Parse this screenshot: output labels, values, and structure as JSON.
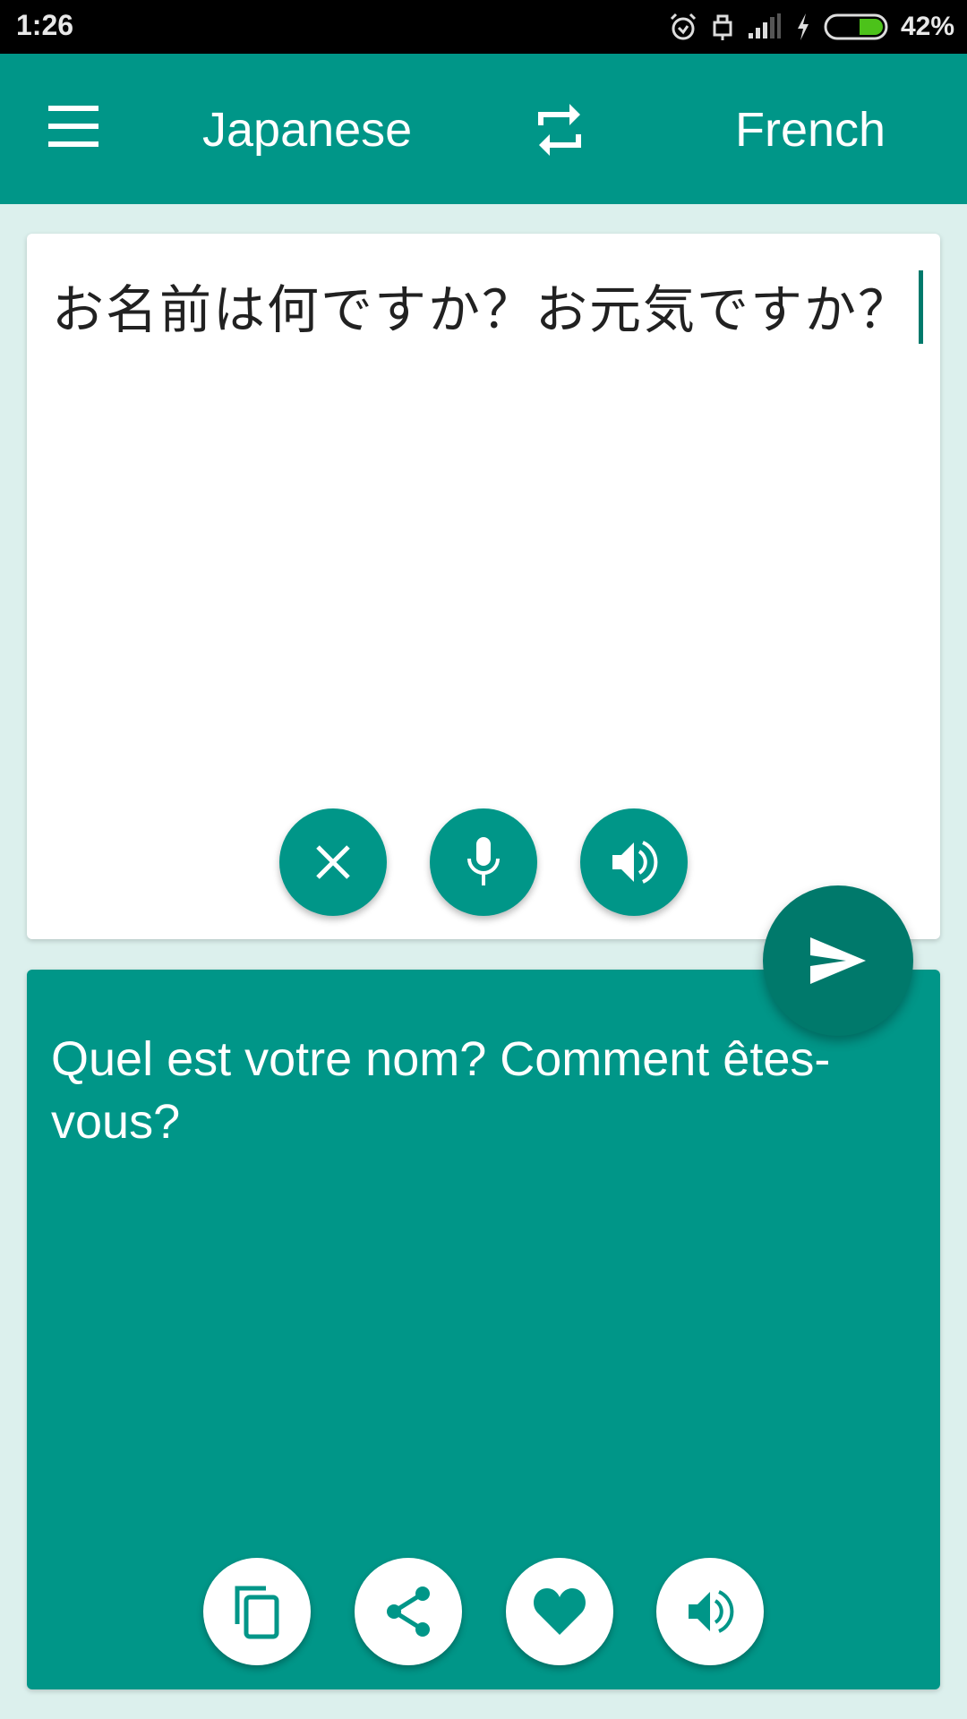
{
  "status_bar": {
    "time": "1:26",
    "icons": [
      "alarm-icon",
      "usb-lock-icon",
      "signal-icon",
      "charging-icon",
      "battery-icon"
    ],
    "battery_percent": "42%",
    "battery_level": 0.42
  },
  "toolbar": {
    "menu_icon": "hamburger-menu-icon",
    "source_language": "Japanese",
    "swap_icon": "swap-languages-icon",
    "target_language": "French"
  },
  "input": {
    "text": "お名前は何ですか？お元気ですか？",
    "actions": [
      {
        "name": "clear",
        "icon": "close-icon"
      },
      {
        "name": "microphone",
        "icon": "microphone-icon"
      },
      {
        "name": "speak",
        "icon": "speaker-icon"
      }
    ]
  },
  "translate_button": {
    "icon": "send-icon"
  },
  "output": {
    "text": "Quel est votre nom? Comment êtes-vous?",
    "actions": [
      {
        "name": "copy",
        "icon": "copy-icon"
      },
      {
        "name": "share",
        "icon": "share-icon"
      },
      {
        "name": "favorite",
        "icon": "heart-icon"
      },
      {
        "name": "speak",
        "icon": "speaker-icon"
      }
    ]
  },
  "colors": {
    "primary": "#009688",
    "primary_dark": "#00796b",
    "background": "#dcf0ed",
    "battery_fill": "#4cc21a"
  }
}
